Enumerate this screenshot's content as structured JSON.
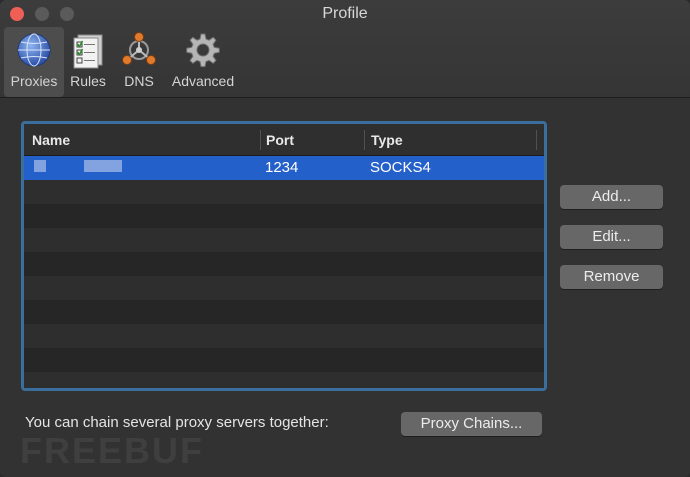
{
  "window": {
    "title": "Profile"
  },
  "toolbar": {
    "items": [
      {
        "label": "Proxies",
        "icon": "globe-icon",
        "selected": true
      },
      {
        "label": "Rules",
        "icon": "rules-checklist-icon",
        "selected": false
      },
      {
        "label": "DNS",
        "icon": "dns-network-icon",
        "selected": false
      },
      {
        "label": "Advanced",
        "icon": "gear-icon",
        "selected": false
      }
    ]
  },
  "proxies_table": {
    "columns": [
      "Name",
      "Port",
      "Type"
    ],
    "rows": [
      {
        "name": "",
        "port": "1234",
        "type": "SOCKS4",
        "selected": true
      }
    ]
  },
  "buttons": {
    "add": "Add...",
    "edit": "Edit...",
    "remove": "Remove",
    "proxy_chains": "Proxy Chains..."
  },
  "hint": "You can chain several proxy servers together:",
  "watermark": "FREEBUF",
  "colors": {
    "selection": "#2460c9",
    "table_border": "#3a6e9c",
    "close_button": "#ee5f56"
  }
}
